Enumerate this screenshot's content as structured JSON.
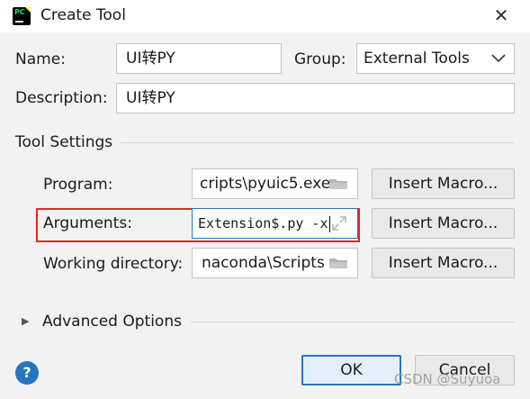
{
  "window": {
    "title": "Create Tool",
    "close_glyph": "✕",
    "app_icon": "pycharm-icon"
  },
  "form": {
    "name_label": "Name:",
    "name_value": "UI转PY",
    "group_label": "Group:",
    "group_value": "External Tools",
    "description_label": "Description:",
    "description_value": "UI转PY"
  },
  "tool_settings": {
    "heading": "Tool Settings",
    "program_label": "Program:",
    "program_value": "cripts\\pyuic5.exe",
    "arguments_label": "Arguments:",
    "arguments_value": "Extension$.py -x",
    "working_dir_label": "Working directory:",
    "working_dir_value": "naconda\\Scripts",
    "insert_macro_label": "Insert Macro...",
    "highlight_color": "#e0282e"
  },
  "advanced": {
    "label": "Advanced Options",
    "expand_glyph": "▶"
  },
  "footer": {
    "help_glyph": "?",
    "ok_label": "OK",
    "cancel_label": "Cancel",
    "watermark": "CSDN @Suyuoa",
    "accent_color": "#2675bf"
  }
}
